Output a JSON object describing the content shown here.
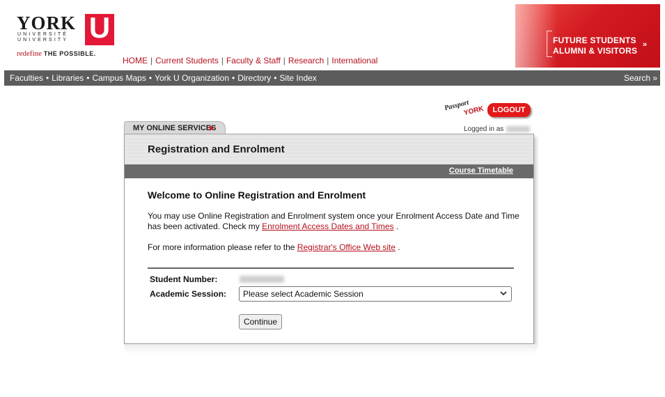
{
  "logo": {
    "name": "YORK",
    "sub1": "UNIVERSITÉ",
    "sub2": "UNIVERSITY",
    "u": "U",
    "tagline_a": "redefine",
    "tagline_b": "THE POSSIBLE."
  },
  "top_nav": [
    "HOME",
    "Current Students",
    "Faculty & Staff",
    "Research",
    "International"
  ],
  "top_nav_sep": "|",
  "promo": {
    "line1": "FUTURE STUDENTS",
    "line2": "ALUMNI & VISITORS",
    "arrow": "»"
  },
  "nav_bar": {
    "links": [
      "Faculties",
      "Libraries",
      "Campus Maps",
      "York U Organization",
      "Directory",
      "Site Index"
    ],
    "dot": "•",
    "search": "Search »"
  },
  "passport": {
    "line1": "Passport",
    "line2": "YORK"
  },
  "logout_label": "LOGOUT",
  "logged_in_label": "Logged in as",
  "tab_label": "MY ONLINE SERVICES",
  "panel": {
    "title": "Registration and Enrolment",
    "timetable_link": "Course Timetable",
    "welcome": "Welcome to Online Registration and Enrolment",
    "para1_text": "You may use Online Registration and Enrolment system once your Enrolment Access Date and Time has been activated. Check my",
    "para1_link": "Enrolment Access Dates and Times",
    "para1_end": ".",
    "para2_text": "For more information please refer to the",
    "para2_link": "Registrar's Office Web site",
    "para2_end": ".",
    "student_number_label": "Student Number:",
    "academic_session_label": "Academic Session:",
    "session_placeholder": "Please select Academic Session",
    "continue_label": "Continue"
  },
  "colors": {
    "brand_red": "#e31837",
    "link_red": "#b4111e",
    "nav_grey": "#5c5c5c"
  }
}
